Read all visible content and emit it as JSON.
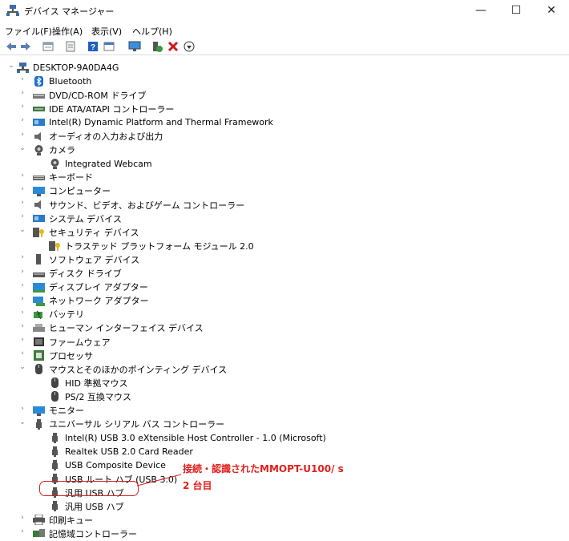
{
  "window": {
    "title": "デバイス マネージャー",
    "controls": {
      "minimize": "—",
      "maximize": "☐",
      "close": "✕"
    }
  },
  "menu": [
    "ファイル(F)",
    "操作(A)",
    "表示(V)",
    "ヘルプ(H)"
  ],
  "toolbar_icons": [
    "back-arrow-icon",
    "forward-arrow-icon",
    "properties-icon",
    "show-hidden-icon",
    "help-icon",
    "update-driver-icon",
    "scan-hardware-icon",
    "add-legacy-icon",
    "uninstall-icon",
    "disable-icon"
  ],
  "tree": [
    {
      "label": "DESKTOP-9A0DA4G",
      "depth": 0,
      "exp": "open",
      "icon": "computer-icon"
    },
    {
      "label": "Bluetooth",
      "depth": 1,
      "exp": "closed",
      "icon": "bluetooth-icon"
    },
    {
      "label": "DVD/CD-ROM ドライブ",
      "depth": 1,
      "exp": "closed",
      "icon": "dvd-drive-icon"
    },
    {
      "label": "IDE ATA/ATAPI コントローラー",
      "depth": 1,
      "exp": "closed",
      "icon": "ide-controller-icon"
    },
    {
      "label": "Intel(R) Dynamic Platform and Thermal Framework",
      "depth": 1,
      "exp": "closed",
      "icon": "system-device-icon"
    },
    {
      "label": "オーディオの入力および出力",
      "depth": 1,
      "exp": "closed",
      "icon": "audio-icon"
    },
    {
      "label": "カメラ",
      "depth": 1,
      "exp": "open",
      "icon": "camera-icon"
    },
    {
      "label": "Integrated Webcam",
      "depth": 2,
      "exp": "none",
      "icon": "camera-icon"
    },
    {
      "label": "キーボード",
      "depth": 1,
      "exp": "closed",
      "icon": "keyboard-icon"
    },
    {
      "label": "コンピューター",
      "depth": 1,
      "exp": "closed",
      "icon": "monitor-icon"
    },
    {
      "label": "サウンド、ビデオ、およびゲーム コントローラー",
      "depth": 1,
      "exp": "closed",
      "icon": "audio-icon"
    },
    {
      "label": "システム デバイス",
      "depth": 1,
      "exp": "closed",
      "icon": "system-device-icon"
    },
    {
      "label": "セキュリティ デバイス",
      "depth": 1,
      "exp": "open",
      "icon": "security-device-icon"
    },
    {
      "label": "トラステッド プラットフォーム モジュール 2.0",
      "depth": 2,
      "exp": "none",
      "icon": "security-device-icon"
    },
    {
      "label": "ソフトウェア デバイス",
      "depth": 1,
      "exp": "closed",
      "icon": "software-device-icon"
    },
    {
      "label": "ディスク ドライブ",
      "depth": 1,
      "exp": "closed",
      "icon": "disk-drive-icon"
    },
    {
      "label": "ディスプレイ アダプター",
      "depth": 1,
      "exp": "closed",
      "icon": "display-adapter-icon"
    },
    {
      "label": "ネットワーク アダプター",
      "depth": 1,
      "exp": "closed",
      "icon": "network-adapter-icon"
    },
    {
      "label": "バッテリ",
      "depth": 1,
      "exp": "closed",
      "icon": "battery-icon"
    },
    {
      "label": "ヒューマン インターフェイス デバイス",
      "depth": 1,
      "exp": "closed",
      "icon": "hid-icon"
    },
    {
      "label": "ファームウェア",
      "depth": 1,
      "exp": "closed",
      "icon": "firmware-icon"
    },
    {
      "label": "プロセッサ",
      "depth": 1,
      "exp": "closed",
      "icon": "processor-icon"
    },
    {
      "label": "マウスとそのほかのポインティング デバイス",
      "depth": 1,
      "exp": "open",
      "icon": "mouse-icon"
    },
    {
      "label": "HID 準拠マウス",
      "depth": 2,
      "exp": "none",
      "icon": "mouse-icon"
    },
    {
      "label": "PS/2 互換マウス",
      "depth": 2,
      "exp": "none",
      "icon": "mouse-icon"
    },
    {
      "label": "モニター",
      "depth": 1,
      "exp": "closed",
      "icon": "monitor-icon"
    },
    {
      "label": "ユニバーサル シリアル バス コントローラー",
      "depth": 1,
      "exp": "open",
      "icon": "usb-icon"
    },
    {
      "label": "Intel(R) USB 3.0 eXtensible Host Controller - 1.0 (Microsoft)",
      "depth": 2,
      "exp": "none",
      "icon": "usb-icon"
    },
    {
      "label": "Realtek USB 2.0 Card Reader",
      "depth": 2,
      "exp": "none",
      "icon": "usb-icon"
    },
    {
      "label": "USB Composite Device",
      "depth": 2,
      "exp": "none",
      "icon": "usb-icon"
    },
    {
      "label": "USB ルート ハブ (USB 3.0)",
      "depth": 2,
      "exp": "none",
      "icon": "usb-icon"
    },
    {
      "label": "汎用 USB ハブ",
      "depth": 2,
      "exp": "none",
      "icon": "usb-icon"
    },
    {
      "label": "汎用 USB ハブ",
      "depth": 2,
      "exp": "none",
      "icon": "usb-icon"
    },
    {
      "label": "印刷キュー",
      "depth": 1,
      "exp": "closed",
      "icon": "printer-icon"
    },
    {
      "label": "記憶域コントローラー",
      "depth": 1,
      "exp": "closed",
      "icon": "storage-controller-icon"
    }
  ],
  "annotation": {
    "line1": "接続・認識されたMMOPT-U100/ s",
    "line2": "2 台目",
    "color": "#e0201c"
  }
}
